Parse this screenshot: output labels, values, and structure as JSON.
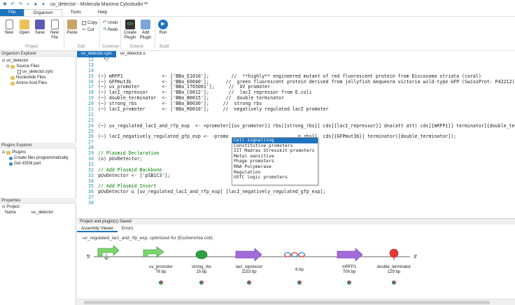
{
  "window": {
    "title": "uv_detector - Molecula Maxima Cytostudio™"
  },
  "menu": {
    "file": "File",
    "organism": "Organism",
    "tools": "Tools",
    "help": "Help"
  },
  "ribbon": {
    "new": "New",
    "open": "Open",
    "save": "Save",
    "new_file": "New\nFile",
    "paste": "Paste",
    "copy": "Copy",
    "cut": "Cut",
    "undo": "Undo",
    "redo": "Redo",
    "create_plugin": "Create\nPlugin",
    "add_plugin": "Add\nPlugin",
    "run": "Run",
    "groups": {
      "project": "Project",
      "edit": "Edit",
      "common": "Common",
      "extend": "Extend",
      "build": "Build"
    }
  },
  "organism_explorer": {
    "header": "Organism Explorer",
    "root": "uv_detector",
    "source_files": "Source Files",
    "source_file": "uv_detector.cyto",
    "nucleotide_files": "Nucleotide Files",
    "amino_acid_files": "Amino Acid Files"
  },
  "plugins_explorer": {
    "header": "Plugins Explorer",
    "root": "Plugins",
    "item1": "Create files programmatically",
    "item2": "Get iGEM part"
  },
  "properties": {
    "header": "Properties",
    "section": "Project",
    "name_label": "Name",
    "name_value": "uv_detector"
  },
  "editor_tabs": [
    "uv_detector.cyto",
    "uv_detector.o"
  ],
  "editor": {
    "line_numbers": [
      "12",
      "13",
      "14",
      "15",
      "16",
      "17",
      "18",
      "19",
      "20",
      "21",
      "22",
      "23",
      "24",
      "25",
      "26",
      "27",
      "28",
      "29",
      "30",
      "31",
      "32",
      "33",
      "34",
      "35",
      "36",
      "37",
      "38"
    ],
    "lines": [
      "  */",
      "",
      "",
      "(~) mRFP1              <- ['BBa_E1010'];        //  **highly** engineered mutant of red fluorescent protein from Discosoma striata (coral)",
      "(~) GFPmut3b           <- ['BBa_E0040'];      //  green fluorescent protein derived from jellyfish Aequeora victoria wild-type GFP (SwissProt: P42212)",
      "(~) uv_promoter        <- ['BBa_I765001'];     //  UV promoter",
      "(~) lacI_repressor     <- ['BBa_C0012'];       //  lacI repressor from E.coli",
      "(~) double_terminator  <- ['BBa_B0015'];      //  double terminator",
      "(~) strong_rbs         <- ['BBa_B0030'];     //  strong rbs",
      "(~) lacI_promoter      <- ['BBa_R0010'];     //  negatively regulated lacI promoter",
      "",
      "",
      "(~) uv_regulated_lacI_and_rfp_exp  <- +promoter[{uv_promoter}] rbs[{strong_rbs}] cds[{lacI_repressor}] dna(att att) cds[{mRFP1}] terminator[{double_termin",
      "",
      "(~) lacI_negatively_regulated_gfp_exp <- -promo                         g_rbs}]  cds[{GFPmut3b}] terminator([double_terminator]);",
      "",
      "",
      "// Plasmid Declaration",
      "(o) pUvDetector;",
      "",
      "// Add Plasmid Backbone",
      "pUvDetector <- ['pSB1C3'];",
      "",
      "// Add Plasmid Insert",
      "pUvDetector u [uv_regulated_lacI_and_rfp_exp] [lacI_negatively_regulated_gfp_exp];",
      "",
      ""
    ]
  },
  "autocomplete": [
    "Cell signalling",
    "Constitutive promoters",
    "IIT Madras Stresskit promoters",
    "Metal sensitive",
    "Phage promoters",
    "RNA Polymerase",
    "Regulation",
    "USTC logic promoters"
  ],
  "status": "Project and plugin(s) Saved",
  "bottom_tabs": [
    "Assembly Viewer",
    "Errors"
  ],
  "assembly": {
    "title": "uv_regulated_lacI_and_rfp_exp, optimized for (Escherichia coli)",
    "five_prime": "5'",
    "three_prime": "3'",
    "parts": [
      {
        "name": "uv_promoter",
        "size": "76 bp"
      },
      {
        "name": "strong_rbs",
        "size": "15 bp"
      },
      {
        "name": "lacI_repressor",
        "size": "1153 bp"
      },
      {
        "name": "",
        "size": "6 bp"
      },
      {
        "name": "mRFP1",
        "size": "706 bp"
      },
      {
        "name": "double_terminator",
        "size": "129 bp"
      }
    ]
  },
  "colors": {
    "accent": "#1e73be",
    "promoter": "#7dd66a",
    "rbs": "#2ea043",
    "cds": "#a26bd8",
    "terminator": "#e53935"
  }
}
